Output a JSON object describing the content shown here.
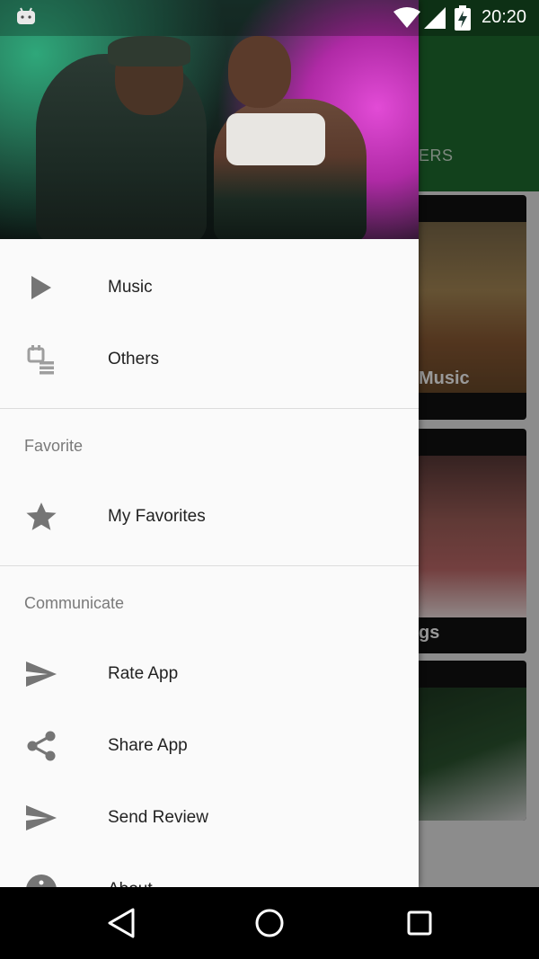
{
  "status_bar": {
    "time": "20:20"
  },
  "background": {
    "tab_label": "ERS",
    "cards": [
      {
        "title": "Music"
      },
      {
        "title": "gs"
      },
      {
        "title": ""
      }
    ]
  },
  "drawer": {
    "items_primary": [
      {
        "label": "Music",
        "icon": "play-icon"
      },
      {
        "label": "Others",
        "icon": "calendar-list-icon"
      }
    ],
    "favorite_section": {
      "header": "Favorite",
      "items": [
        {
          "label": "My Favorites",
          "icon": "star-icon"
        }
      ]
    },
    "communicate_section": {
      "header": "Communicate",
      "items": [
        {
          "label": "Rate App",
          "icon": "send-icon"
        },
        {
          "label": "Share App",
          "icon": "share-icon"
        },
        {
          "label": "Send Review",
          "icon": "send-icon"
        },
        {
          "label": "About",
          "icon": "info-icon"
        }
      ]
    }
  },
  "colors": {
    "toolbar": "#1f6d2f",
    "drawer_bg": "#fafafa",
    "icon_gray": "#757575"
  }
}
